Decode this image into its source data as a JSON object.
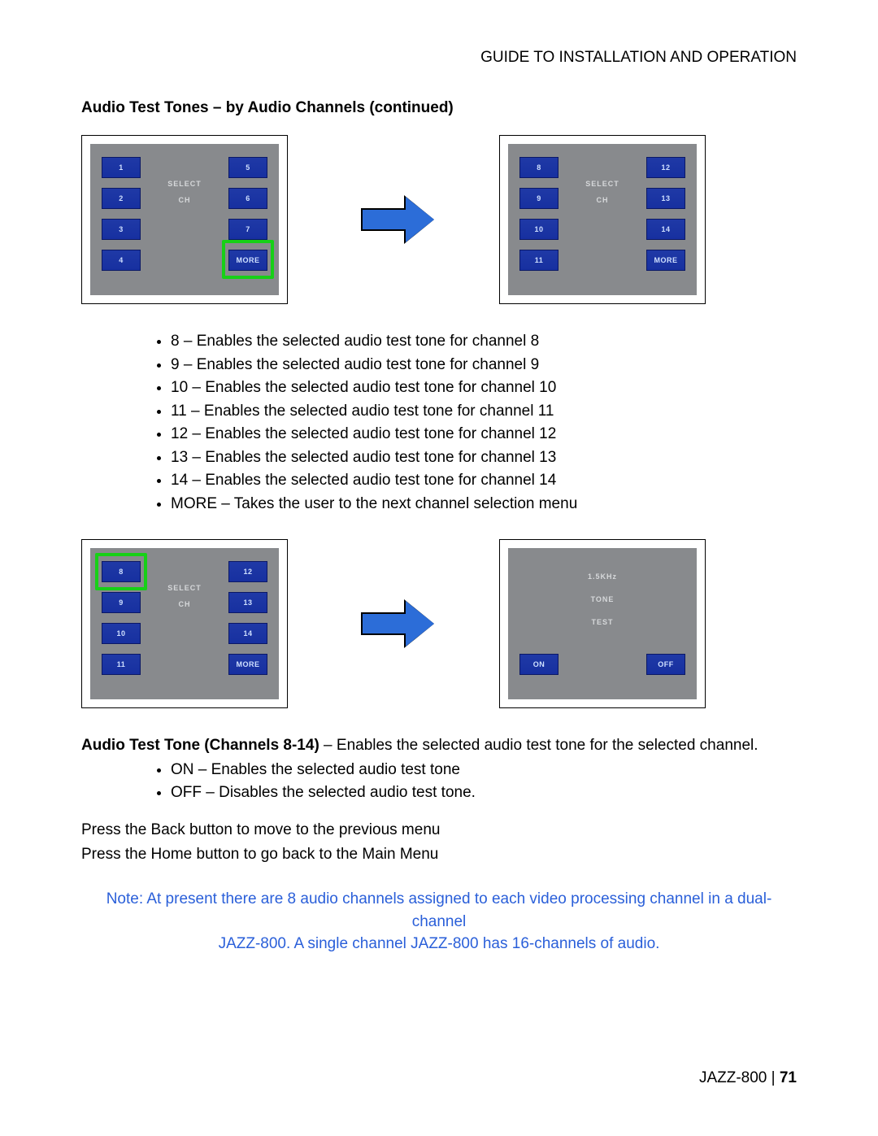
{
  "header": {
    "title": "GUIDE TO INSTALLATION AND OPERATION"
  },
  "section_title": "Audio Test Tones – by Audio Channels (continued)",
  "panels": {
    "p1": {
      "center_top": "SELECT",
      "center_bot": "CH",
      "left": [
        "1",
        "2",
        "3",
        "4"
      ],
      "right": [
        "5",
        "6",
        "7",
        "MORE"
      ]
    },
    "p2": {
      "center_top": "SELECT",
      "center_bot": "CH",
      "left": [
        "8",
        "9",
        "10",
        "11"
      ],
      "right": [
        "12",
        "13",
        "14",
        "MORE"
      ]
    },
    "p3": {
      "center_top": "SELECT",
      "center_bot": "CH",
      "left": [
        "8",
        "9",
        "10",
        "11"
      ],
      "right": [
        "12",
        "13",
        "14",
        "MORE"
      ]
    },
    "p4": {
      "center1": "1.5KHz",
      "center2": "TONE",
      "center3": "TEST",
      "on": "ON",
      "off": "OFF"
    }
  },
  "bullets1": [
    "8 – Enables the selected audio test tone for channel 8",
    "9 – Enables the selected audio test tone for channel 9",
    "10 – Enables the selected audio test tone for channel 10",
    "11 – Enables the selected audio test tone for channel 11",
    "12 – Enables the selected audio test tone for channel 12",
    "13 – Enables the selected audio test tone for channel 13",
    "14 – Enables the selected audio test tone for channel 14",
    "MORE – Takes the user to the next channel selection menu"
  ],
  "subheading": {
    "bold": "Audio Test Tone (Channels 8-14)",
    "rest": " – Enables the selected audio test tone for the selected channel."
  },
  "bullets2": [
    "ON – Enables the selected audio test tone",
    "OFF – Disables the selected audio test tone."
  ],
  "para_nav1": "Press the Back button to move to the previous menu",
  "para_nav2": "Press the Home button to go back to the Main Menu",
  "note_l1": "Note: At present there are 8 audio channels assigned to each video processing channel in a dual-channel",
  "note_l2": "JAZZ-800. A single channel JAZZ-800 has 16-channels of audio.",
  "footer": {
    "product": "JAZZ-800  |  ",
    "page": "71"
  }
}
